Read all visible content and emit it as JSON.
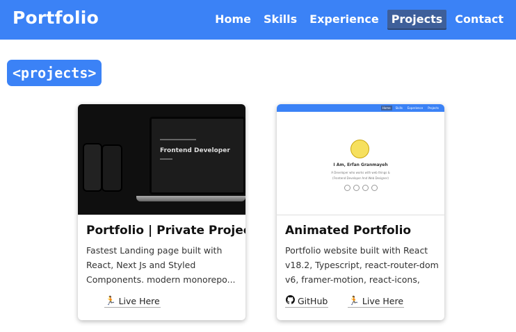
{
  "header": {
    "brand": "Portfolio",
    "nav": [
      "Home",
      "Skills",
      "Experience",
      "Projects",
      "Contact"
    ],
    "active_nav": "Projects"
  },
  "section": {
    "tag": "<projects>"
  },
  "projects": [
    {
      "title": "Portfolio | Private Project",
      "description": "Fastest Landing page built with React, Next Js and Styled Components. modern monorepo...",
      "links": [
        {
          "label": "Live Here",
          "icon": "runner-icon"
        }
      ],
      "thumb": {
        "mock_title": "Frontend Developer"
      }
    },
    {
      "title": "Animated Portfolio",
      "description": "Portfolio website built with React v18.2, Typescript, react-router-dom v6, framer-motion, react-icons, Scss",
      "links": [
        {
          "label": "GitHub",
          "icon": "github-icon"
        },
        {
          "label": "Live Here",
          "icon": "runner-icon"
        }
      ],
      "thumb": {
        "nav": [
          "Home",
          "Skills",
          "Experience",
          "Projects"
        ],
        "name": "I Am, Erfan Granmayeh",
        "sub1": "A Developer who works with web things &",
        "sub2": "(Frontend Developer And Web Designer)"
      }
    }
  ],
  "colors": {
    "accent": "#3b82f6",
    "active_nav": "#3e5f9a"
  }
}
